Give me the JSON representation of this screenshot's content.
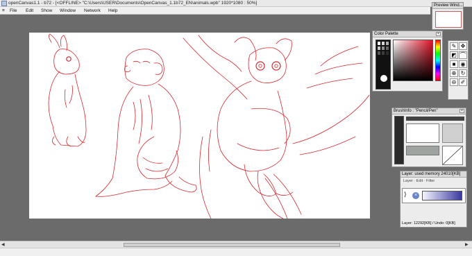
{
  "window": {
    "title": "openCanvas1.1 - b72 - [<OFFLINE>  \"C:\\Users\\USER\\Documents\\OpenCanvas_1.1b72_EN\\animals.wpb\" 1920*1080 : 50%]"
  },
  "menu": {
    "items": [
      "File",
      "Edit",
      "Show",
      "Window",
      "Network",
      "Help"
    ]
  },
  "panels": {
    "preview": {
      "title": "Preview Wind..."
    },
    "color_palette": {
      "title": "Color Palette"
    },
    "brush_info": {
      "title": "BrushInfo : \"Pencil/Pen\""
    },
    "layers": {
      "title": "Layer: used memory 24010[KB]",
      "menu": [
        "Layer",
        "Edit",
        "Filter"
      ],
      "footer": "Layer: 12292[KB] / Undo: 0[KB]"
    }
  },
  "colors": {
    "sketch_red": "#d9262b",
    "canvas_bg": "#ffffff",
    "workspace_bg": "#6b6b6b",
    "current_color": "#000000"
  },
  "icons": [
    "app-icon",
    "close-icon",
    "pen-icon",
    "hand-icon",
    "eraser-icon",
    "lasso-icon",
    "zoom-icon",
    "bucket-icon",
    "eye-icon"
  ]
}
